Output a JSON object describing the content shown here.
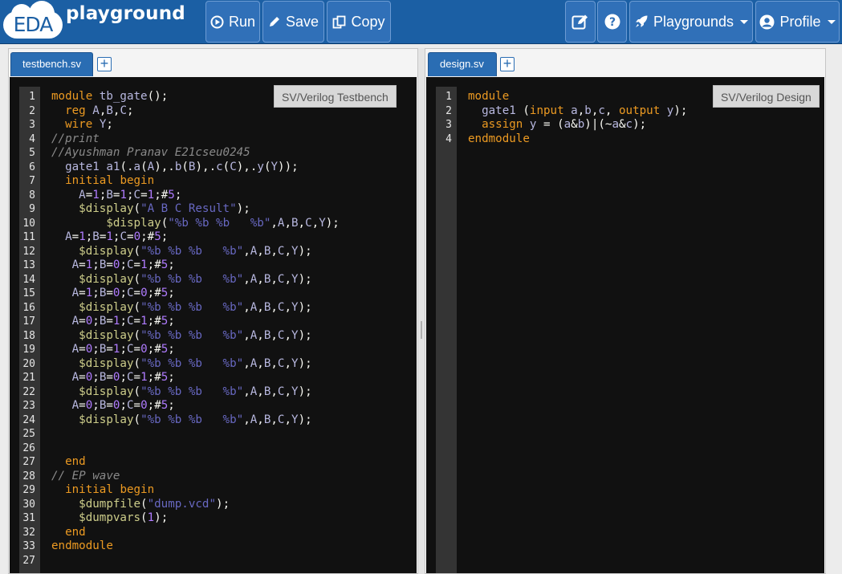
{
  "header": {
    "logo_eda": "EDA",
    "logo_playground": "playground",
    "run_label": "Run",
    "save_label": "Save",
    "copy_label": "Copy",
    "playgrounds_label": "Playgrounds",
    "profile_label": "Profile",
    "icons": [
      "play-circle-icon",
      "pencil-icon",
      "copy-icon",
      "edit-icon",
      "question-icon",
      "rocket-icon",
      "user-icon",
      "chevron-down-icon"
    ]
  },
  "left_pane": {
    "tab_label": "testbench.sv",
    "add_tab_label": "+",
    "language_badge": "SV/Verilog Testbench",
    "lines": [
      {
        "n": "1",
        "t": "module tb_gate();"
      },
      {
        "n": "2",
        "t": "  reg A,B,C;"
      },
      {
        "n": "3",
        "t": "  wire Y;"
      },
      {
        "n": "4",
        "t": "//print"
      },
      {
        "n": "5",
        "t": "//Ayushman Pranav E21cseu0245"
      },
      {
        "n": "6",
        "t": "  gate1 a1(.a(A),.b(B),.c(C),.y(Y));"
      },
      {
        "n": "7",
        "t": "  initial begin"
      },
      {
        "n": "8",
        "t": "    A=1;B=1;C=1;#5;"
      },
      {
        "n": "9",
        "t": "    $display(\"A B C Result\");"
      },
      {
        "n": "10",
        "t": "        $display(\"%b %b %b   %b\",A,B,C,Y);"
      },
      {
        "n": "11",
        "t": "  A=1;B=1;C=0;#5;"
      },
      {
        "n": "12",
        "t": "    $display(\"%b %b %b   %b\",A,B,C,Y);"
      },
      {
        "n": "13",
        "t": "   A=1;B=0;C=1;#5;"
      },
      {
        "n": "14",
        "t": "    $display(\"%b %b %b   %b\",A,B,C,Y);"
      },
      {
        "n": "15",
        "t": "   A=1;B=0;C=0;#5;"
      },
      {
        "n": "16",
        "t": "    $display(\"%b %b %b   %b\",A,B,C,Y);"
      },
      {
        "n": "17",
        "t": "   A=0;B=1;C=1;#5;"
      },
      {
        "n": "18",
        "t": "    $display(\"%b %b %b   %b\",A,B,C,Y);"
      },
      {
        "n": "19",
        "t": "   A=0;B=1;C=0;#5;"
      },
      {
        "n": "20",
        "t": "    $display(\"%b %b %b   %b\",A,B,C,Y);"
      },
      {
        "n": "21",
        "t": "   A=0;B=0;C=1;#5;"
      },
      {
        "n": "22",
        "t": "    $display(\"%b %b %b   %b\",A,B,C,Y);"
      },
      {
        "n": "23",
        "t": "   A=0;B=0;C=0;#5;"
      },
      {
        "n": "24",
        "t": "    $display(\"%b %b %b   %b\",A,B,C,Y);"
      },
      {
        "n": "25",
        "t": ""
      },
      {
        "n": "26",
        "t": ""
      },
      {
        "n": "27",
        "t": "  end"
      },
      {
        "n": "28",
        "t": "// EP wave"
      },
      {
        "n": "29",
        "t": "  initial begin"
      },
      {
        "n": "30",
        "t": "    $dumpfile(\"dump.vcd\");"
      },
      {
        "n": "31",
        "t": "    $dumpvars(1);"
      },
      {
        "n": "32",
        "t": "  end"
      },
      {
        "n": "33",
        "t": "endmodule"
      },
      {
        "n": "27",
        "t": ""
      }
    ]
  },
  "right_pane": {
    "tab_label": "design.sv",
    "add_tab_label": "+",
    "language_badge": "SV/Verilog Design",
    "lines": [
      {
        "n": "1",
        "t": "module"
      },
      {
        "n": "2",
        "t": "  gate1 (input a,b,c, output y);"
      },
      {
        "n": "3",
        "t": "  assign y = (a&b)|(~a&c);"
      },
      {
        "n": "4",
        "t": "endmodule"
      }
    ]
  },
  "colors": {
    "header_bg": "#1b5fa4",
    "button_bg": "#3070b8",
    "keyword": "#ec9a22",
    "string": "#6868c2",
    "comment": "#8a8a8a",
    "editor_bg": "#111111"
  }
}
